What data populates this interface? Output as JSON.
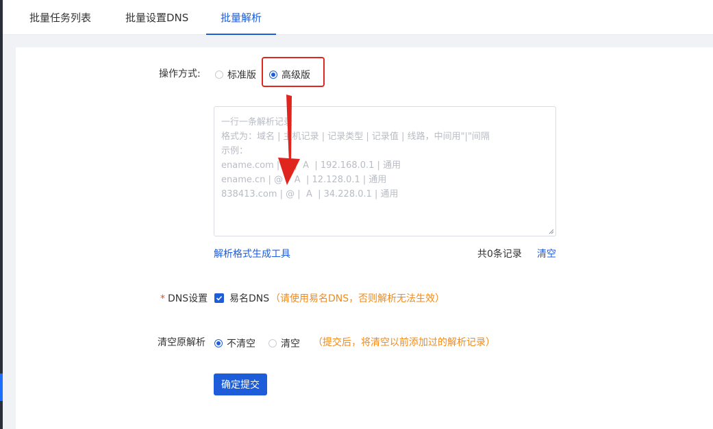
{
  "tabs": [
    {
      "label": "批量任务列表"
    },
    {
      "label": "批量设置DNS"
    },
    {
      "label": "批量解析"
    }
  ],
  "form": {
    "mode_label": "操作方式:",
    "mode_options": [
      {
        "label": "标准版",
        "checked": false
      },
      {
        "label": "高级版",
        "checked": true
      }
    ],
    "textarea": {
      "value": "",
      "placeholder": "一行一条解析记录\n格式为：域名 | 主机记录 | 记录类型 | 记录值 | 线路，中间用\"|\"间隔\n示例：\nename.com | @ |  A  | 192.168.0.1 | 通用\nename.cn | @ |  A  | 12.128.0.1 | 通用\n838413.com | @ |  A  | 34.228.0.1 | 通用"
    },
    "tool_link": "解析格式生成工具",
    "record_count": "共0条记录",
    "clear_link": "清空",
    "dns_label": "DNS设置",
    "dns_required": "*",
    "dns_checkbox_label": "易名DNS",
    "dns_hint": "（请使用易名DNS，否则解析无法生效）",
    "clear_original_label": "清空原解析",
    "clear_options": [
      {
        "label": "不清空",
        "checked": true
      },
      {
        "label": "清空",
        "checked": false
      }
    ],
    "clear_hint": "（提交后，将清空以前添加过的解析记录）",
    "submit_label": "确定提交"
  },
  "colors": {
    "accent": "#1e5dd9",
    "warning": "#f08a1c",
    "annotation_red": "#e0251f"
  }
}
